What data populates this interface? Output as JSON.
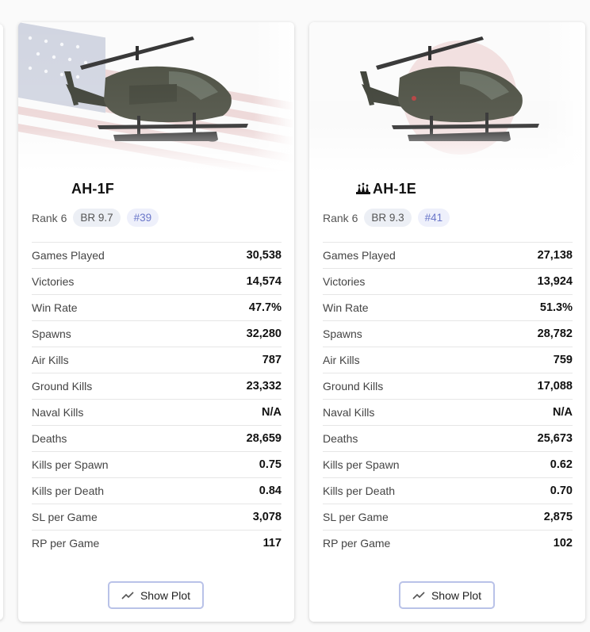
{
  "cards": [
    {
      "name": "AH-1F",
      "flag_icon": "usa-flag",
      "rank": "Rank 6",
      "br": "BR 9.7",
      "position": "#39",
      "stats": [
        {
          "label": "Games Played",
          "value": "30,538"
        },
        {
          "label": "Victories",
          "value": "14,574"
        },
        {
          "label": "Win Rate",
          "value": "47.7%"
        },
        {
          "label": "Spawns",
          "value": "32,280"
        },
        {
          "label": "Air Kills",
          "value": "787"
        },
        {
          "label": "Ground Kills",
          "value": "23,332"
        },
        {
          "label": "Naval Kills",
          "value": "N/A"
        },
        {
          "label": "Deaths",
          "value": "28,659"
        },
        {
          "label": "Kills per Spawn",
          "value": "0.75"
        },
        {
          "label": "Kills per Death",
          "value": "0.84"
        },
        {
          "label": "SL per Game",
          "value": "3,078"
        },
        {
          "label": "RP per Game",
          "value": "117"
        }
      ],
      "button_label": "Show Plot"
    },
    {
      "name": "AH-1E",
      "flag_icon": "japan-flag",
      "rank": "Rank 6",
      "br": "BR 9.3",
      "position": "#41",
      "stats": [
        {
          "label": "Games Played",
          "value": "27,138"
        },
        {
          "label": "Victories",
          "value": "13,924"
        },
        {
          "label": "Win Rate",
          "value": "51.3%"
        },
        {
          "label": "Spawns",
          "value": "28,782"
        },
        {
          "label": "Air Kills",
          "value": "759"
        },
        {
          "label": "Ground Kills",
          "value": "17,088"
        },
        {
          "label": "Naval Kills",
          "value": "N/A"
        },
        {
          "label": "Deaths",
          "value": "25,673"
        },
        {
          "label": "Kills per Spawn",
          "value": "0.62"
        },
        {
          "label": "Kills per Death",
          "value": "0.70"
        },
        {
          "label": "SL per Game",
          "value": "2,875"
        },
        {
          "label": "RP per Game",
          "value": "102"
        }
      ],
      "button_label": "Show Plot"
    }
  ],
  "colors": {
    "accent": "#6b77c9",
    "chip_bg": "#eceff5",
    "button_border": "#b9c2e8"
  }
}
